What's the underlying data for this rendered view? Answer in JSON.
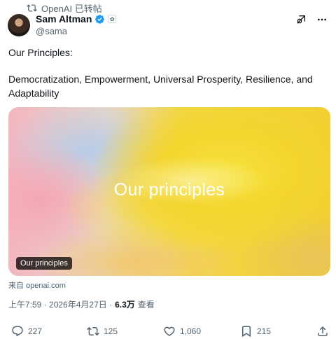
{
  "repost": {
    "text": "OpenAI 已转帖",
    "icon": "repost-icon"
  },
  "author": {
    "name": "Sam Altman",
    "handle": "@sama",
    "verified_icon": "verified-badge-icon",
    "affiliation_icon": "openai-affiliate-icon"
  },
  "header_icons": [
    "grok-icon",
    "more-icon"
  ],
  "post": {
    "line1": "Our Principles:",
    "line2": "Democratization, Empowerment, Universal Prosperity, Resilience, and",
    "line3": "Adaptability"
  },
  "card": {
    "title": "Our principles",
    "badge": "Our principles"
  },
  "source": "来自 openai.com",
  "meta": {
    "time": "上午7:59 · 2026年4月27日 · ",
    "views": "6.3万",
    "views_label": "查看"
  },
  "actions": {
    "replies": "227",
    "reposts": "125",
    "likes": "1,060",
    "bookmarks": "215"
  },
  "colors": {
    "text": "#0f1419",
    "secondary": "#536471",
    "verified": "#1d9bf0"
  }
}
